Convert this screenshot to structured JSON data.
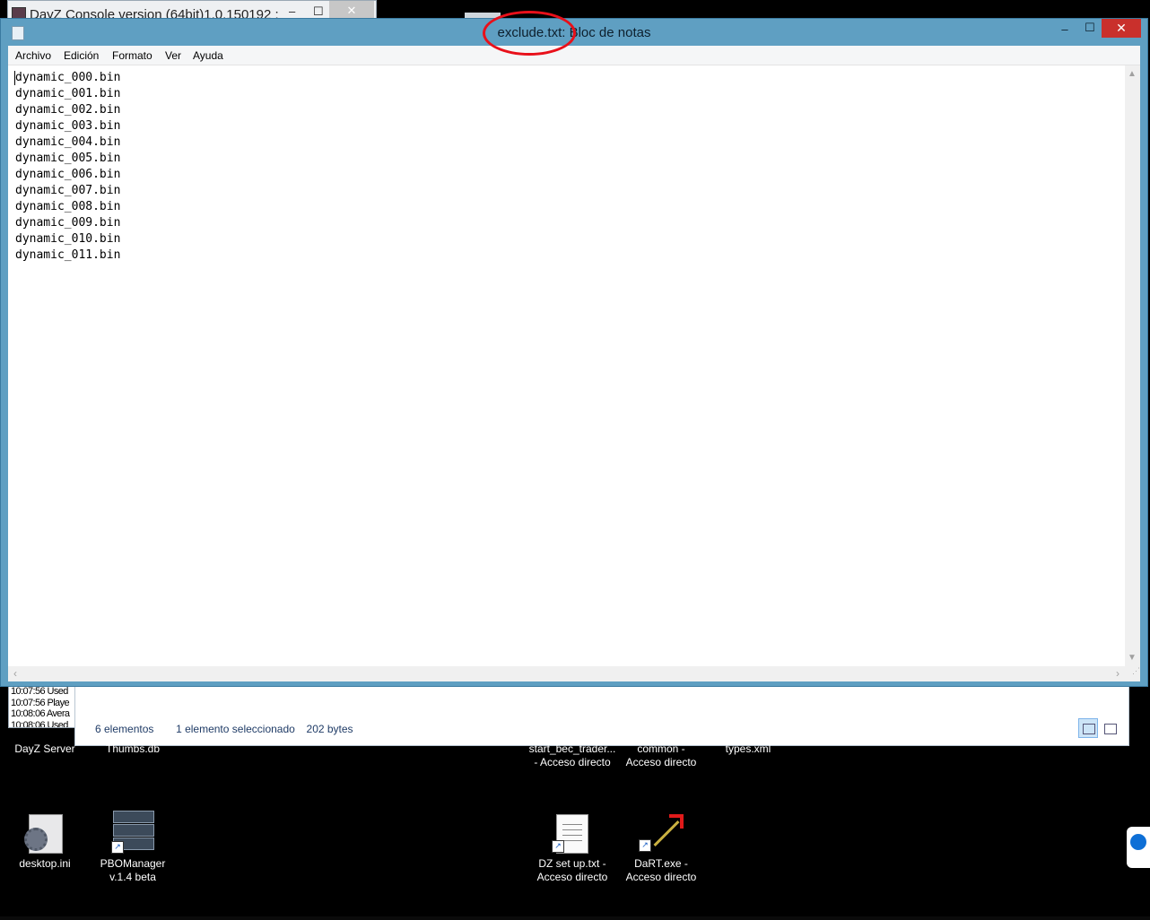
{
  "background_window": {
    "title": "DayZ Console version (64bit)1.0.150192 :",
    "minimize": "‒",
    "maximize": "☐",
    "close": "✕",
    "log_lines": [
      "10:07:56 Used",
      "10:07:56 Playe",
      "10:08:06 Avera",
      "10:08:06 Used"
    ]
  },
  "explorer": {
    "item_count": "6 elementos",
    "selection": "1 elemento seleccionado",
    "size": "202 bytes"
  },
  "notepad": {
    "title": "exclude.txt: Bloc de notas",
    "minimize": "‒",
    "maximize": "☐",
    "close": "✕",
    "menu": [
      "Archivo",
      "Edición",
      "Formato",
      "Ver",
      "Ayuda"
    ],
    "lines": [
      "dynamic_000.bin",
      "dynamic_001.bin",
      "dynamic_002.bin",
      "dynamic_003.bin",
      "dynamic_004.bin",
      "dynamic_005.bin",
      "dynamic_006.bin",
      "dynamic_007.bin",
      "dynamic_008.bin",
      "dynamic_009.bin",
      "dynamic_010.bin",
      "dynamic_011.bin"
    ]
  },
  "desktop": {
    "dayz_server": "DayZ Server",
    "thumbs": "Thumbs.db",
    "start_bec": [
      "start_bec_trader...",
      "- Acceso directo"
    ],
    "common": [
      "common -",
      "Acceso directo"
    ],
    "types": "types.xml",
    "desktop_ini": "desktop.ini",
    "pbomanager": [
      "PBOManager",
      "v.1.4 beta"
    ],
    "dz_setup": [
      "DZ set up.txt -",
      "Acceso directo"
    ],
    "dart": [
      "DaRT.exe -",
      "Acceso directo"
    ]
  },
  "annotation": {
    "color": "#e8101a"
  }
}
